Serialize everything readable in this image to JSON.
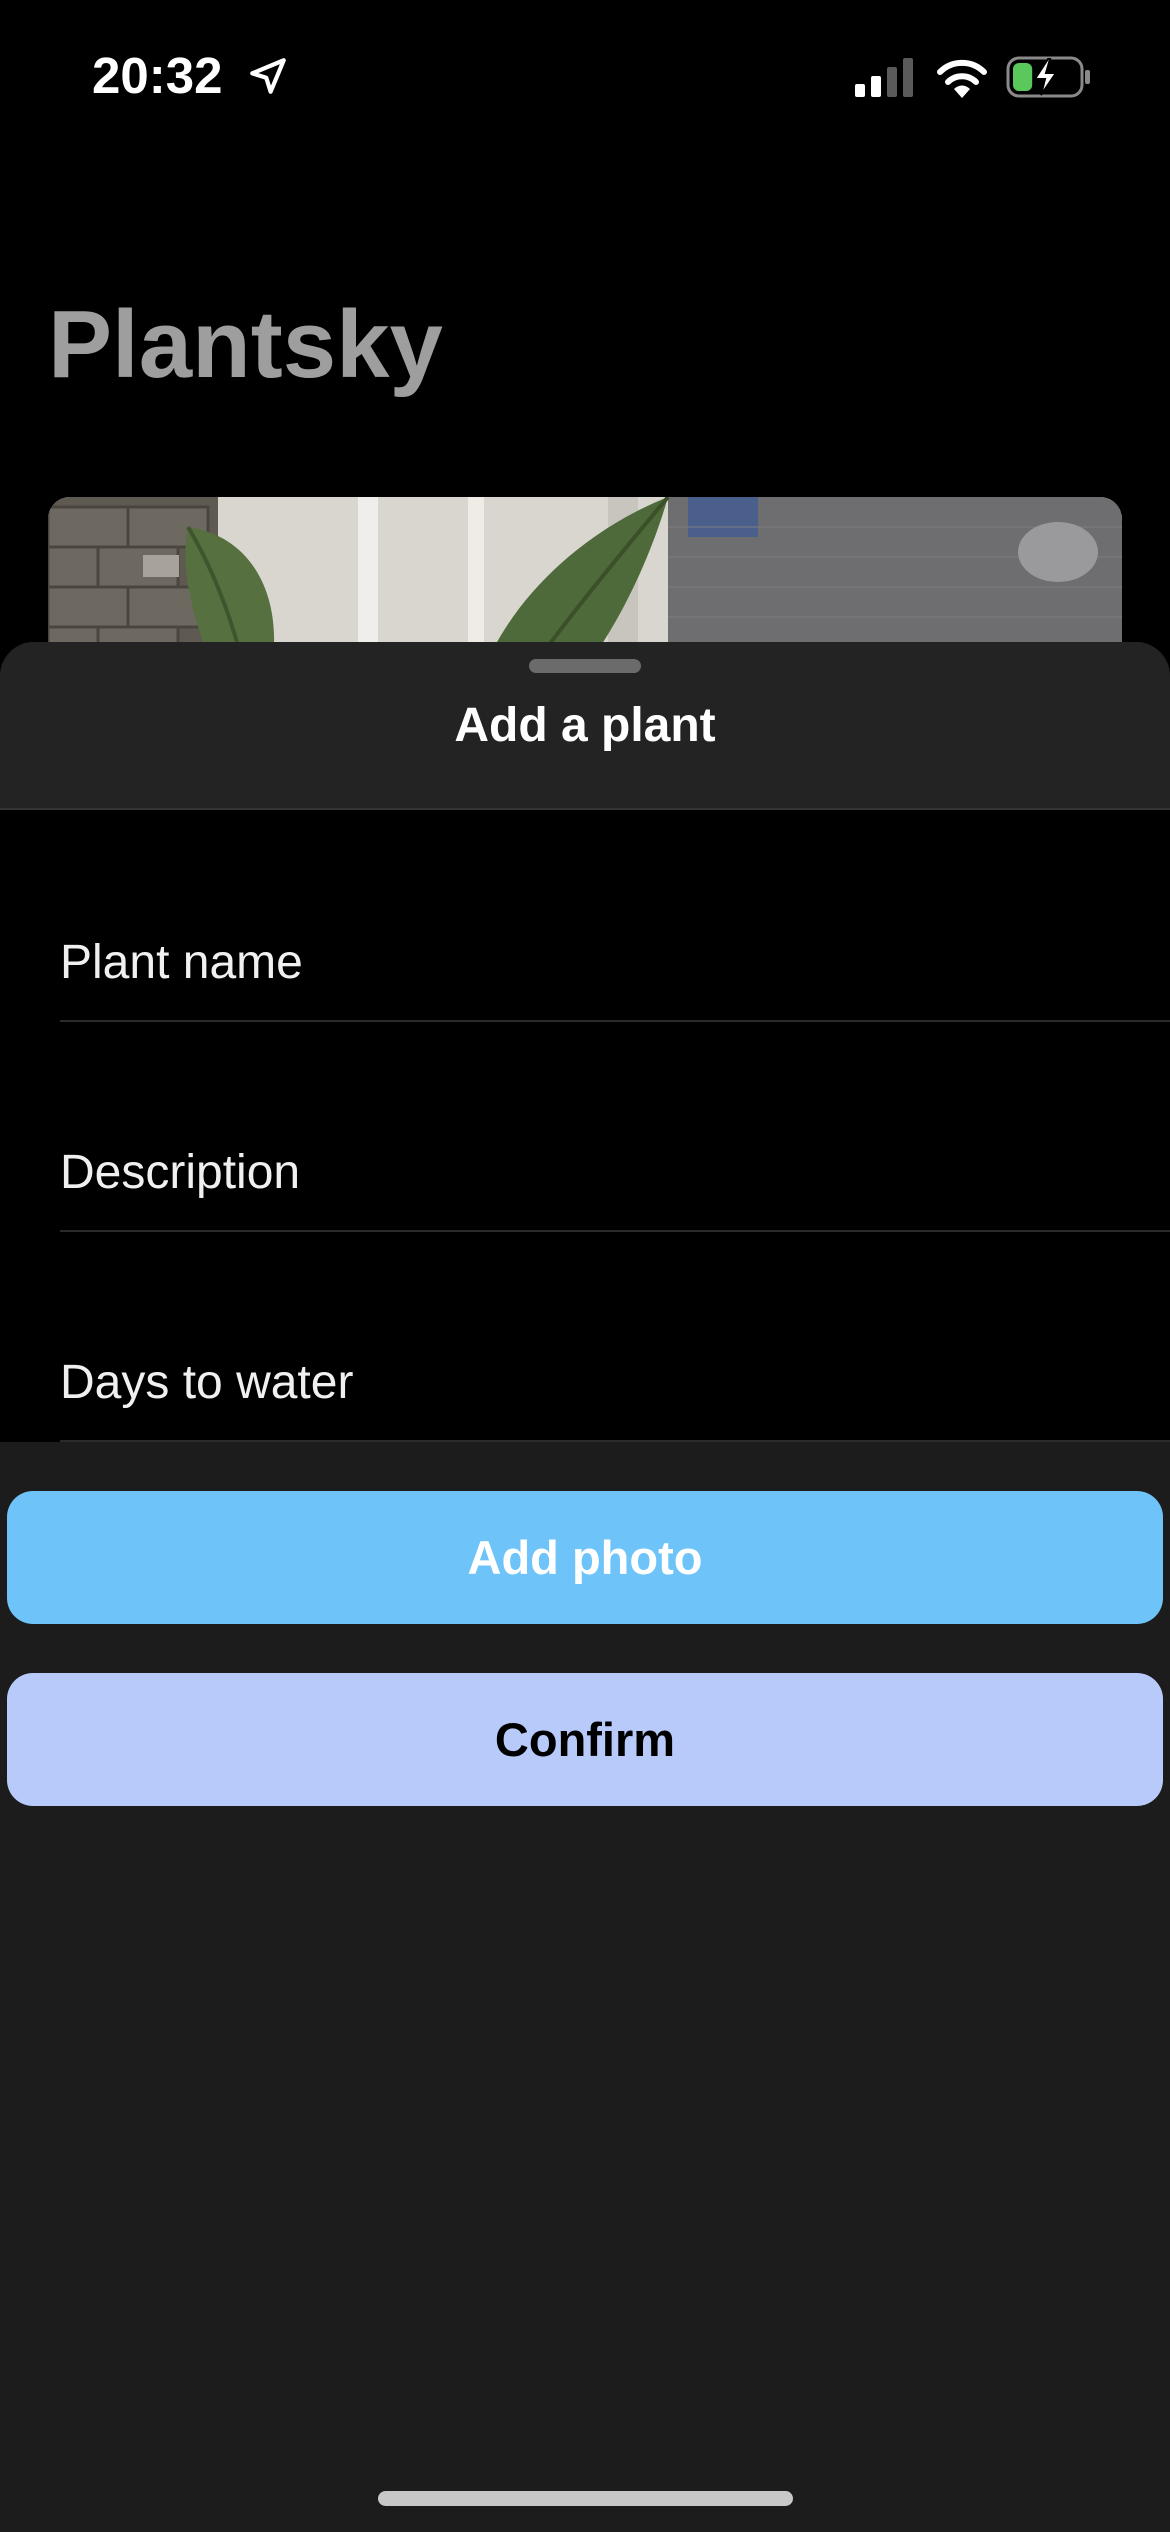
{
  "status_bar": {
    "time": "20:32",
    "icons": [
      "location-arrow-icon",
      "cellular-signal-icon",
      "wifi-icon",
      "battery-charging-icon"
    ],
    "signal_bars_active": 2,
    "signal_bars_total": 4,
    "battery_level": 0.3,
    "battery_color": "#5ac85a"
  },
  "app": {
    "title": "Plantsky"
  },
  "sheet": {
    "title": "Add a plant",
    "fields": [
      {
        "placeholder": "Plant name",
        "value": ""
      },
      {
        "placeholder": "Description",
        "value": ""
      },
      {
        "placeholder": "Days to water",
        "value": ""
      }
    ],
    "add_photo_label": "Add photo",
    "confirm_label": "Confirm"
  },
  "colors": {
    "add_photo_button": "#6ec3f9",
    "confirm_button": "#b7cafa",
    "sheet_background": "#1c1c1c"
  }
}
